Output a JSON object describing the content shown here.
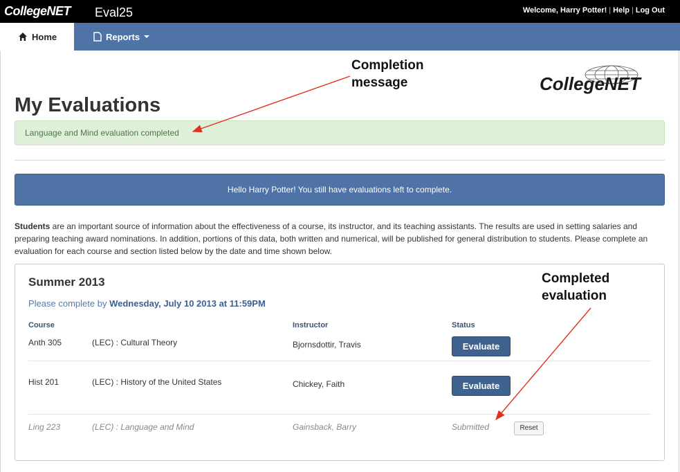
{
  "topbar": {
    "logo_text": "CollegeNET",
    "app_name": "Eval25",
    "welcome": "Welcome, Harry Potter!",
    "help": "Help",
    "logout": "Log Out"
  },
  "nav": {
    "home": "Home",
    "reports": "Reports"
  },
  "logo": {
    "text": "CollegeNET"
  },
  "page": {
    "title": "My Evaluations",
    "success_message": "Language and Mind evaluation completed",
    "hello_banner": "Hello Harry Potter! You still have evaluations left to complete.",
    "intro_bold": "Students",
    "intro_rest": " are an important source of information about the effectiveness of a course, its instructor, and its teaching assistants. The results are used in setting salaries and preparing teaching award nominations. In addition, portions of this data, both written and numerical, will be published for general distribution to students. Please complete an evaluation for each course and section listed below by the date and time shown below."
  },
  "panel": {
    "term": "Summer 2013",
    "deadline_prefix": "Please complete by ",
    "deadline": "Wednesday, July 10 2013 at 11:59PM",
    "headers": {
      "course": "Course",
      "instructor": "Instructor",
      "status": "Status"
    },
    "rows": [
      {
        "code": "Anth 305",
        "section": "(LEC) : Cultural Theory",
        "instructor": "Bjornsdottir, Travis",
        "action": "Evaluate"
      },
      {
        "code": "Hist 201",
        "section": "(LEC) : History of the United States",
        "instructor": "Chickey, Faith",
        "action": "Evaluate"
      },
      {
        "code": "Ling 223",
        "section": "(LEC) : Language and Mind",
        "instructor": "Gainsback, Barry",
        "status": "Submitted",
        "action": "Reset"
      }
    ]
  },
  "annotations": {
    "completion_line1": "Completion",
    "completion_line2": "message",
    "completed_line1": "Completed",
    "completed_line2": "evaluation"
  },
  "colors": {
    "nav": "#4f73a6",
    "success_bg": "#dff0d8",
    "button": "#3f628f",
    "arrow": "#e0301e"
  }
}
